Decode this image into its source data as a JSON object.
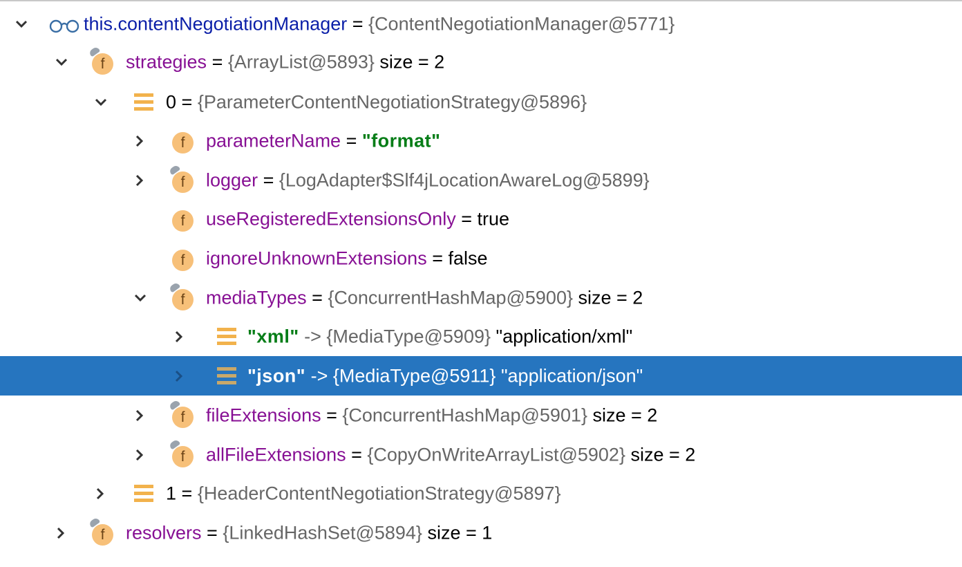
{
  "colors": {
    "selection": "#2675bf",
    "field_name": "#871094",
    "string_value": "#067d17",
    "object_ref": "#666666",
    "field_icon": "#f7c079",
    "array_icon": "#f2b24c"
  },
  "rows": [
    {
      "expander": "expanded",
      "icon": "watch-glasses-icon",
      "name": "this.contentNegotiationManager",
      "eq": " = ",
      "value": "{ContentNegotiationManager@5771}",
      "extra": ""
    },
    {
      "expander": "expanded",
      "icon": "field-pinned-icon",
      "name": "strategies",
      "eq": " = ",
      "value": "{ArrayList@5893}",
      "extra": "  size = 2"
    },
    {
      "expander": "expanded",
      "icon": "array-element-icon",
      "name": "0",
      "eq": " = ",
      "value": "{ParameterContentNegotiationStrategy@5896}",
      "extra": ""
    },
    {
      "expander": "collapsed",
      "icon": "field-icon",
      "name": "parameterName",
      "eq": " = ",
      "value": "\"format\"",
      "extra": ""
    },
    {
      "expander": "collapsed",
      "icon": "field-pinned-icon",
      "name": "logger",
      "eq": " = ",
      "value": "{LogAdapter$Slf4jLocationAwareLog@5899}",
      "extra": ""
    },
    {
      "expander": "none",
      "icon": "field-icon",
      "name": "useRegisteredExtensionsOnly",
      "eq": " = ",
      "value": "true",
      "extra": ""
    },
    {
      "expander": "none",
      "icon": "field-icon",
      "name": "ignoreUnknownExtensions",
      "eq": " = ",
      "value": "false",
      "extra": ""
    },
    {
      "expander": "expanded",
      "icon": "field-pinned-icon",
      "name": "mediaTypes",
      "eq": " = ",
      "value": "{ConcurrentHashMap@5900}",
      "extra": "  size = 2"
    },
    {
      "expander": "collapsed",
      "icon": "array-element-icon",
      "name": "\"xml\"",
      "eq": " -> ",
      "value": "{MediaType@5909}",
      "extra": " \"application/xml\""
    },
    {
      "expander": "collapsed",
      "icon": "array-element-icon",
      "name": "\"json\"",
      "eq": " -> ",
      "value": "{MediaType@5911}",
      "extra": " \"application/json\""
    },
    {
      "expander": "collapsed",
      "icon": "field-pinned-icon",
      "name": "fileExtensions",
      "eq": " = ",
      "value": "{ConcurrentHashMap@5901}",
      "extra": "  size = 2"
    },
    {
      "expander": "collapsed",
      "icon": "field-pinned-icon",
      "name": "allFileExtensions",
      "eq": " = ",
      "value": "{CopyOnWriteArrayList@5902}",
      "extra": "  size = 2"
    },
    {
      "expander": "collapsed",
      "icon": "array-element-icon",
      "name": "1",
      "eq": " = ",
      "value": "{HeaderContentNegotiationStrategy@5897}",
      "extra": ""
    },
    {
      "expander": "collapsed",
      "icon": "field-pinned-icon",
      "name": "resolvers",
      "eq": " = ",
      "value": "{LinkedHashSet@5894}",
      "extra": "  size = 1"
    }
  ]
}
